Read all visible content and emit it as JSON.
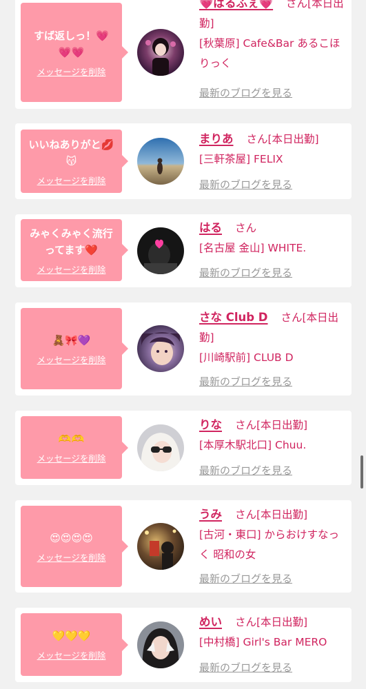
{
  "delete_label": "メッセージを削除",
  "blog_label": "最新のブログを見る",
  "san_label": "さん",
  "colors": {
    "bubble": "#fe9aa9",
    "accent": "#d0245f",
    "muted": "#999999",
    "background": "#f1f1f1"
  },
  "cards": [
    {
      "message": "すば返しっ！💗\n💗💗",
      "name": "💗ぱるふぇ💗",
      "status": "[本日出勤]",
      "shop": "[秋葉原] Cafe&Bar あるこほりっく",
      "avatar_icon": "profile-photo"
    },
    {
      "message": "いいねありがと💋\n😽",
      "name": "まりあ",
      "status": "[本日出勤]",
      "shop": "[三軒茶屋] FELIX",
      "avatar_icon": "profile-photo"
    },
    {
      "message": "みゃくみゃく流行\nってます❤️",
      "name": "はる",
      "status": "",
      "shop": "[名古屋 金山] WHITE.",
      "avatar_icon": "profile-photo"
    },
    {
      "message": "🧸🎀💜",
      "name": "さな Club D",
      "status": "[本日出勤]",
      "shop": "[川崎駅前] CLUB D",
      "avatar_icon": "profile-photo"
    },
    {
      "message": "🫶🫶",
      "name": "りな",
      "status": "[本日出勤]",
      "shop": "[本厚木駅北口] Chuu.",
      "avatar_icon": "profile-photo"
    },
    {
      "message": "😍😍😍😍",
      "name": "うみ",
      "status": "[本日出勤]",
      "shop": "[古河・東口] からおけすなっく 昭和の女",
      "avatar_icon": "profile-photo"
    },
    {
      "message": "💛💛💛",
      "name": "めい",
      "status": "[本日出勤]",
      "shop": "[中村橋] Girl's Bar MERO",
      "avatar_icon": "profile-photo"
    }
  ]
}
